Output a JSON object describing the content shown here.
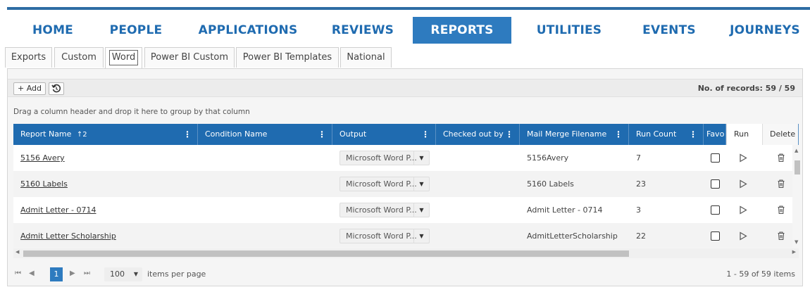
{
  "nav": {
    "items": [
      {
        "label": "HOME"
      },
      {
        "label": "PEOPLE"
      },
      {
        "label": "APPLICATIONS"
      },
      {
        "label": "REVIEWS"
      },
      {
        "label": "REPORTS",
        "active": true
      },
      {
        "label": "UTILITIES"
      },
      {
        "label": "EVENTS"
      },
      {
        "label": "JOURNEYS"
      }
    ]
  },
  "tabs": [
    {
      "label": "Exports"
    },
    {
      "label": "Custom"
    },
    {
      "label": "Word",
      "active": true
    },
    {
      "label": "Power BI Custom"
    },
    {
      "label": "Power BI Templates"
    },
    {
      "label": "National"
    }
  ],
  "toolbar": {
    "add_label": "+ Add",
    "refresh_icon": "history-icon",
    "records_text": "No. of records: 59 / 59"
  },
  "group_hint": "Drag a column header and drop it here to group by that column",
  "grid": {
    "columns": {
      "report_name": "Report Name",
      "sort_indicator": "↑2",
      "condition_name": "Condition Name",
      "output": "Output",
      "checked_out_by": "Checked out by",
      "mail_merge": "Mail Merge Filename",
      "run_count": "Run Count",
      "favorite": "Favo",
      "run": "Run",
      "delete": "Delete"
    },
    "rows": [
      {
        "report_name": "5156 Avery",
        "condition_name": "",
        "output": "Microsoft Word P...",
        "checked_out_by": "",
        "mail_merge": "5156Avery",
        "run_count": "7"
      },
      {
        "report_name": "5160 Labels",
        "condition_name": "",
        "output": "Microsoft Word P...",
        "checked_out_by": "",
        "mail_merge": "5160 Labels",
        "run_count": "23"
      },
      {
        "report_name": "Admit Letter - 0714",
        "condition_name": "",
        "output": "Microsoft Word P...",
        "checked_out_by": "",
        "mail_merge": "Admit Letter - 0714",
        "run_count": "3"
      },
      {
        "report_name": "Admit Letter Scholarship",
        "condition_name": "",
        "output": "Microsoft Word P...",
        "checked_out_by": "",
        "mail_merge": "AdmitLetterScholarship",
        "run_count": "22"
      }
    ]
  },
  "pager": {
    "current_page": "1",
    "page_size": "100",
    "page_size_label": "items per page",
    "range_text": "1 - 59 of 59 items"
  },
  "colors": {
    "nav_text": "#1f6bb0",
    "nav_active_bg": "#2e7bbf",
    "grid_header_bg": "#1f6bb0"
  }
}
